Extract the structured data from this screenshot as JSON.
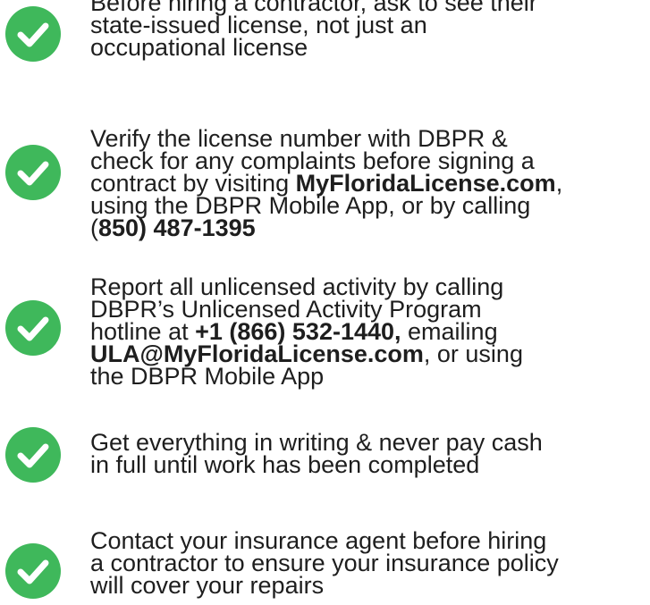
{
  "colors": {
    "check_circle": "#3fb85b",
    "check_mark": "#ffffff",
    "text": "#1e1e1e"
  },
  "icons": {
    "bullet": "check-circle-icon"
  },
  "tips": [
    {
      "lines": [
        [
          {
            "t": "Before hiring a contractor, ask to see their"
          }
        ],
        [
          {
            "t": "state-issued license, not just an"
          }
        ],
        [
          {
            "t": "occupational license"
          }
        ]
      ]
    },
    {
      "lines": [
        [
          {
            "t": "Verify the license number with DBPR &"
          }
        ],
        [
          {
            "t": "check for any complaints before signing a"
          }
        ],
        [
          {
            "t": "contract by visiting "
          },
          {
            "t": "MyFloridaLicense.com",
            "b": true
          },
          {
            "t": ","
          }
        ],
        [
          {
            "t": "using the DBPR Mobile App, or by calling"
          }
        ],
        [
          {
            "t": "("
          },
          {
            "t": "850) 487-1395",
            "b": true
          }
        ]
      ]
    },
    {
      "lines": [
        [
          {
            "t": "Report all unlicensed activity by calling"
          }
        ],
        [
          {
            "t": "DBPR’s Unlicensed Activity Program"
          }
        ],
        [
          {
            "t": "hotline at "
          },
          {
            "t": "+1 (866) 532-1440,",
            "b": true
          },
          {
            "t": " emailing"
          }
        ],
        [
          {
            "t": "ULA@MyFloridaLicense.com",
            "b": true
          },
          {
            "t": ", or using"
          }
        ],
        [
          {
            "t": "the DBPR Mobile App"
          }
        ]
      ]
    },
    {
      "lines": [
        [
          {
            "t": "Get everything in writing & never pay cash"
          }
        ],
        [
          {
            "t": "in full until work has been completed"
          }
        ]
      ]
    },
    {
      "lines": [
        [
          {
            "t": "Contact your insurance agent before hiring"
          }
        ],
        [
          {
            "t": "a contractor to ensure your insurance policy"
          }
        ],
        [
          {
            "t": "will cover your repairs"
          }
        ]
      ]
    }
  ]
}
